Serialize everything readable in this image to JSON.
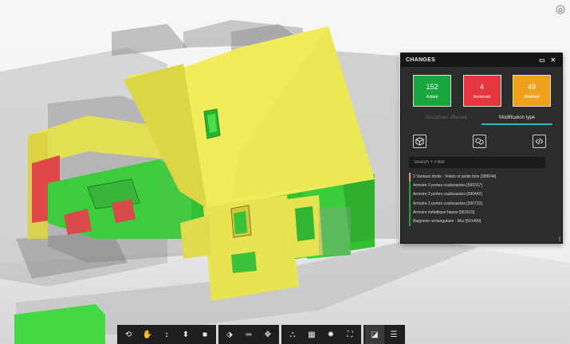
{
  "panel": {
    "title": "CHANGES",
    "stats": [
      {
        "count": "152",
        "label": "Added"
      },
      {
        "count": "4",
        "label": "Removed"
      },
      {
        "count": "49",
        "label": "Modified"
      }
    ],
    "tabs": [
      "Disciplines affected",
      "Modification type"
    ],
    "active_tab": "Modification type",
    "filter_icons": [
      "cube-icon",
      "cube-link-icon",
      "code-icon"
    ],
    "search_placeholder": "Search + Filter",
    "items": [
      {
        "label": "2 Vantaux droits - Volets et petits bois [389044]",
        "type": "modified"
      },
      {
        "label": "Armoire 2 portes coulissantes [590317]",
        "type": "added"
      },
      {
        "label": "Armoire 2 portes coulissantes [590442]",
        "type": "added"
      },
      {
        "label": "Armoire 2 portes coulissantes [590723]",
        "type": "added"
      },
      {
        "label": "Armoire métallique basse [581515]",
        "type": "added"
      },
      {
        "label": "Baignoire rectangulaire - Mur [601499]",
        "type": "added"
      }
    ]
  },
  "colors": {
    "added": "#19a63c",
    "removed": "#e5353d",
    "modified": "#eea21c",
    "active_tab_underline": "#2fb5c9",
    "panel_bg": "#2c2c2c"
  },
  "toolbar": {
    "groups": [
      [
        {
          "name": "orbit-icon",
          "glyph": "⟲"
        },
        {
          "name": "pan-icon",
          "glyph": "✋"
        },
        {
          "name": "zoom-icon",
          "glyph": "↕"
        },
        {
          "name": "walk-icon",
          "glyph": "⬍"
        },
        {
          "name": "camera-icon",
          "glyph": "■"
        }
      ],
      [
        {
          "name": "section-icon",
          "glyph": "⬗"
        },
        {
          "name": "measure-icon",
          "glyph": "═"
        },
        {
          "name": "explode-icon",
          "glyph": "✥"
        }
      ],
      [
        {
          "name": "model-tree-icon",
          "glyph": "⛬"
        },
        {
          "name": "properties-icon",
          "glyph": "▦"
        },
        {
          "name": "settings-icon",
          "glyph": "✹"
        },
        {
          "name": "fullscreen-icon",
          "glyph": "⛶"
        }
      ],
      [
        {
          "name": "compare-icon",
          "glyph": "◪"
        },
        {
          "name": "levels-icon",
          "glyph": "☰"
        }
      ]
    ]
  }
}
